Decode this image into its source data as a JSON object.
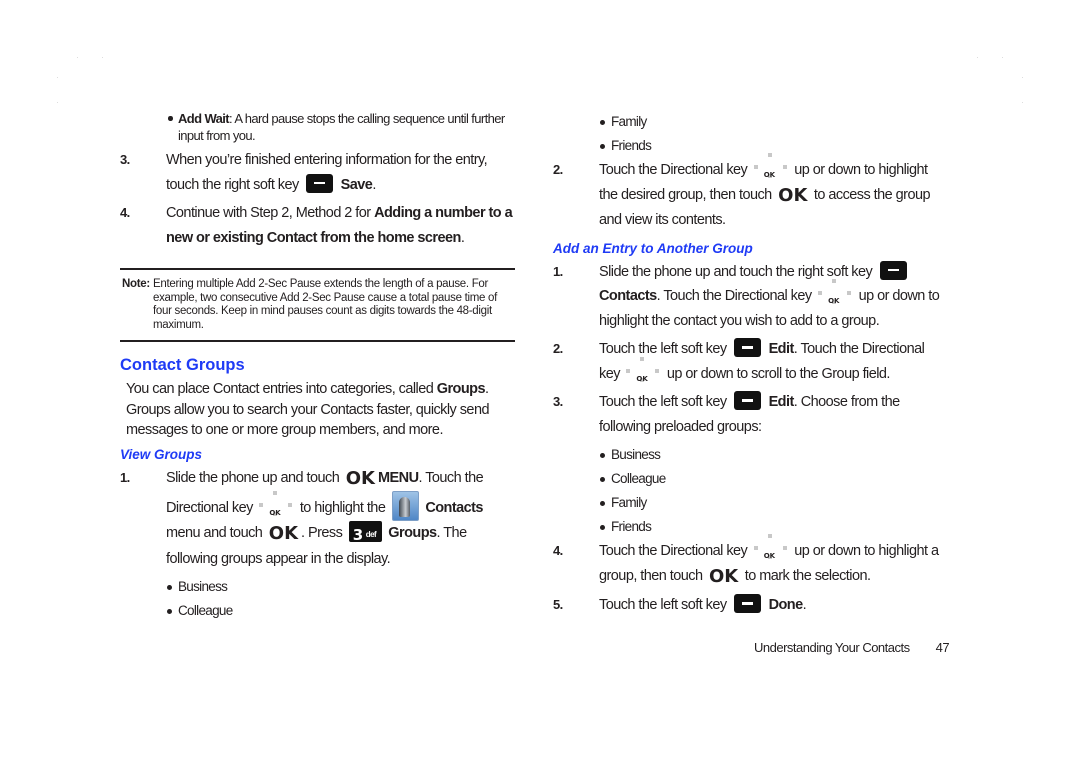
{
  "left_column": {
    "sub_bullet": {
      "term": "Add Wait",
      "text": ": A hard pause stops the calling sequence until further input from you."
    },
    "step3": {
      "num": "3.",
      "text_a": "When you’re finished entering information for the entry, touch the right soft key",
      "bold": "Save",
      "end": "."
    },
    "step4": {
      "num": "4.",
      "text_a": "Continue with Step 2, Method 2 for ",
      "bold": "Adding a number to a new or existing Contact from the home screen",
      "end": "."
    },
    "note": {
      "label": "Note:",
      "text": "Entering multiple Add 2-Sec Pause extends the length of a pause. For example, two consecutive Add 2-Sec Pause cause a total pause time of four seconds. Keep in mind pauses count as digits towards the 48-digit maximum."
    },
    "section_heading": "Contact Groups",
    "intro": {
      "text_a": "You can place Contact entries into categories, called ",
      "bold": "Groups",
      "text_b": ". Groups allow you to search your Contacts faster, quickly send messages to one or more group members, and more."
    },
    "subheading": "View Groups",
    "view_step1": {
      "num": "1.",
      "t1": "Slide the phone up and touch",
      "ok": "OK",
      "menu": "MENU",
      "t2": ". Touch the Directional key",
      "t3": "to highlight the",
      "contacts": "Contacts",
      "t4": "menu and touch",
      "t5": ". Press",
      "key3_num": "3",
      "key3_def": "def",
      "groups": "Groups",
      "t6": ". The following groups appear in the display."
    },
    "groups": [
      "Business",
      "Colleague"
    ]
  },
  "right_column": {
    "groups_cont": [
      "Family",
      "Friends"
    ],
    "view_step2": {
      "num": "2.",
      "t1": "Touch the Directional key",
      "t2": "up or down to highlight the desired group, then touch",
      "ok": "OK",
      "t3": "to access the group and view its contents."
    },
    "subheading": "Add an Entry to Another Group",
    "add_steps": [
      {
        "num": "1.",
        "t1": "Slide the phone up and touch the right soft key",
        "bold": "Contacts",
        "t2": ". Touch the Directional key",
        "t3": "up or down to highlight the contact you wish to add to a group."
      },
      {
        "num": "2.",
        "t1": "Touch the left soft key",
        "bold": "Edit",
        "t2": ". Touch the Directional key",
        "t3": "up or down to scroll to the Group field."
      },
      {
        "num": "3.",
        "t1": "Touch the left soft key",
        "bold": "Edit",
        "t2": ". Choose from the following preloaded groups:"
      },
      {
        "num": "4.",
        "t1": "Touch the Directional key",
        "t2": "up or down to highlight a group, then touch",
        "ok": "OK",
        "t3": "to mark the selection."
      },
      {
        "num": "5.",
        "t1": "Touch the left soft key",
        "bold": "Done",
        "t2": "."
      }
    ],
    "preloaded_groups": [
      "Business",
      "Colleague",
      "Family",
      "Friends"
    ]
  },
  "footer": {
    "section": "Understanding Your Contacts",
    "page": "47"
  },
  "colors": {
    "heading_blue": "#1f3bf5",
    "text": "#231f20"
  }
}
